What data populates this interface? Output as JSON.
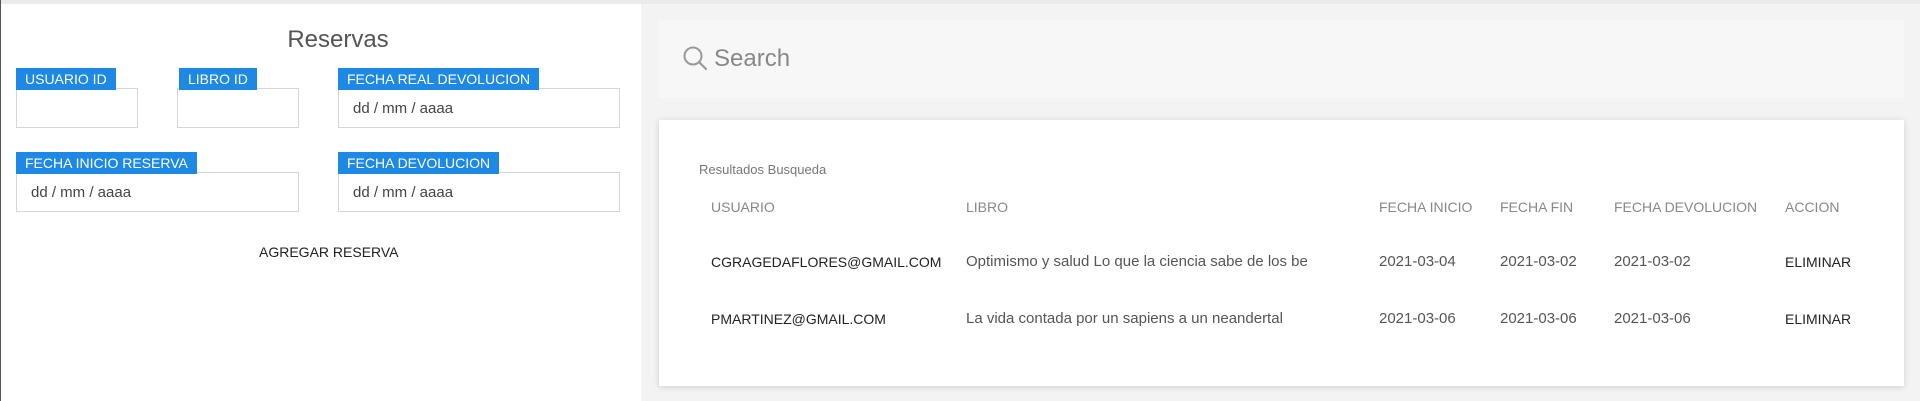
{
  "form": {
    "title": "Reservas",
    "fields": {
      "usuario_id": {
        "label": "USUARIO ID",
        "value": ""
      },
      "libro_id": {
        "label": "LIBRO ID",
        "value": ""
      },
      "fecha_real_devolucion": {
        "label": "FECHA REAL DEVOLUCION",
        "placeholder": "dd / mm / aaaa"
      },
      "fecha_inicio_reserva": {
        "label": "FECHA INICIO RESERVA",
        "placeholder": "dd / mm / aaaa"
      },
      "fecha_devolucion": {
        "label": "FECHA DEVOLUCION",
        "placeholder": "dd / mm / aaaa"
      }
    },
    "submit_label": "AGREGAR RESERVA"
  },
  "search": {
    "placeholder": "Search",
    "icon": "search-icon"
  },
  "results": {
    "title": "Resultados Busqueda",
    "columns": [
      "USUARIO",
      "LIBRO",
      "FECHA INICIO",
      "FECHA FIN",
      "FECHA DEVOLUCION",
      "ACCION"
    ],
    "rows": [
      {
        "usuario": "CGRAGEDAFLORES@GMAIL.COM",
        "libro": "Optimismo y salud Lo que la ciencia sabe de los be",
        "fecha_inicio": "2021-03-04",
        "fecha_fin": "2021-03-02",
        "fecha_devolucion": "2021-03-02",
        "accion": "ELIMINAR"
      },
      {
        "usuario": "PMARTINEZ@GMAIL.COM",
        "libro": "La vida contada por un sapiens a un neandertal",
        "fecha_inicio": "2021-03-06",
        "fecha_fin": "2021-03-06",
        "fecha_devolucion": "2021-03-06",
        "accion": "ELIMINAR"
      }
    ]
  },
  "colors": {
    "accent": "#1e88e5",
    "background": "#f3f3f3",
    "panel": "#ffffff"
  }
}
